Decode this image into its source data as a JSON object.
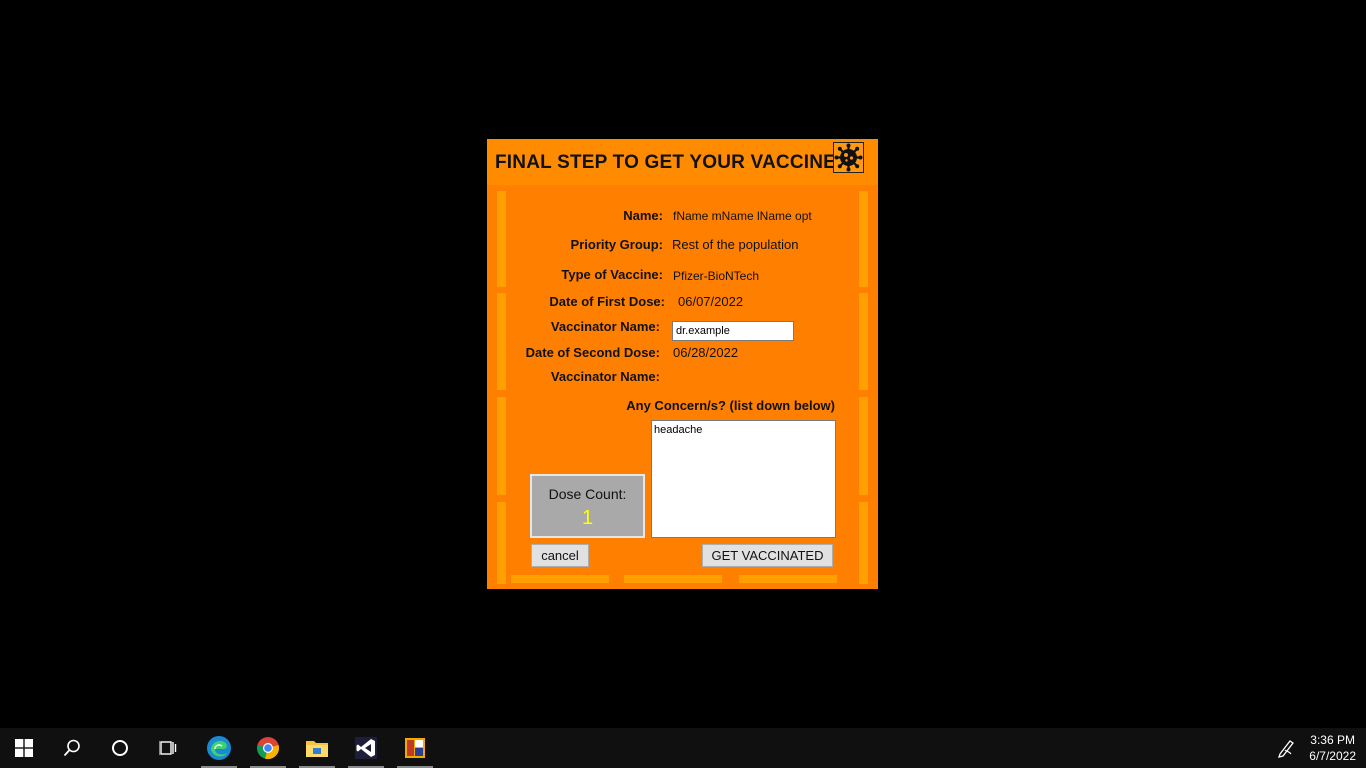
{
  "dialog": {
    "title": "FINAL STEP TO GET YOUR VACCINE",
    "icon": "virus-icon",
    "fields": {
      "name_label": "Name:",
      "name_value": "fName mName lName opt",
      "priority_label": "Priority Group:",
      "priority_value": "Rest of the population",
      "vaccine_label": "Type of Vaccine:",
      "vaccine_value": "Pfizer-BioNTech",
      "first_dose_label": "Date of First Dose:",
      "first_dose_value": "06/07/2022",
      "vaccinator1_label": "Vaccinator Name:",
      "vaccinator1_value": "dr.example",
      "second_dose_label": "Date of Second Dose:",
      "second_dose_value": "06/28/2022",
      "vaccinator2_label": "Vaccinator Name:"
    },
    "concerns": {
      "label": "Any Concern/s? (list down below)",
      "value": "headache"
    },
    "dose_count": {
      "label": "Dose Count:",
      "value": "1"
    },
    "buttons": {
      "cancel": "cancel",
      "get_vaccinated": "GET VACCINATED"
    },
    "colors": {
      "background": "#ff8000",
      "accent_bars": "#ffa000",
      "dose_value": "#ffff00"
    }
  },
  "taskbar": {
    "items": [
      "windows-start-icon",
      "search-icon",
      "cortana-icon",
      "task-view-icon",
      "edge-icon",
      "chrome-icon",
      "file-explorer-icon",
      "visual-studio-icon",
      "app-icon"
    ],
    "time": "3:36 PM",
    "date": "6/7/2022"
  }
}
